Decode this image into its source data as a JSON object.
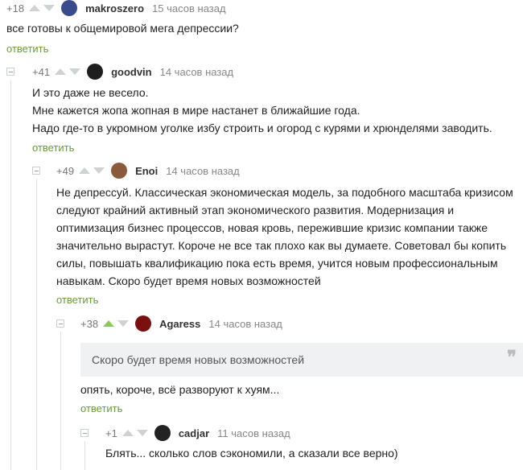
{
  "comments": [
    {
      "rating": "+18",
      "nick": "makroszero",
      "time": "15 часов назад",
      "text_lines": [
        "все готовы к общемировой мега депрессии?"
      ],
      "reply": "ответить",
      "avatar_color": "#3a4b8c"
    },
    {
      "rating": "+41",
      "nick": "goodvin",
      "time": "14 часов назад",
      "text_lines": [
        "И это даже не весело.",
        "Мне кажется жопа жопная в мире настанет в ближайшие года.",
        "Надо где-то в укромном уголке избу строить и огород с курями и хрюнделями заводить."
      ],
      "reply": "ответить",
      "avatar_color": "#1e1e1e"
    },
    {
      "rating": "+49",
      "nick": "Enoi",
      "time": "14 часов назад",
      "text_lines": [
        "Не депрессуй. Классическая экономическая модель, за подобного масштаба кризисом",
        "следуют крайний активный этап экономического развития. Модернизация и",
        "оптимизация бизнес процессов, новая кровь, пережившие кризис компании также",
        "значительно вырастут. Короче не все так плохо как вы думаете. Советовал бы копить",
        "силы, повышать квалификацию пока есть время, учится новым профессиональным",
        "навыкам. Скоро будет время новых возможностей"
      ],
      "reply": "ответить",
      "avatar_color": "#8a5a3a"
    },
    {
      "rating": "+38",
      "nick": "Agaress",
      "time": "14 часов назад",
      "quote": "Скоро будет время новых возможностей",
      "text_lines": [
        "опять, короче, всё разворуют к хуям..."
      ],
      "reply": "ответить",
      "avatar_color": "#7a1010",
      "upvoted": true
    },
    {
      "rating": "+1",
      "nick": "cadjar",
      "time": "11 часов назад",
      "text_lines": [
        "Блять... сколько слов сэкономили, а сказали все верно)"
      ],
      "avatar_color": "#222222"
    }
  ],
  "icons": {
    "upvote": "triangle-up-icon",
    "downvote": "triangle-down-icon",
    "collapse": "minus-box-icon",
    "quote": "quote-icon"
  },
  "colors": {
    "reply_link": "#6a9b3b",
    "upvote_active": "#8ac858",
    "vote_inactive": "#cfd2d5"
  }
}
